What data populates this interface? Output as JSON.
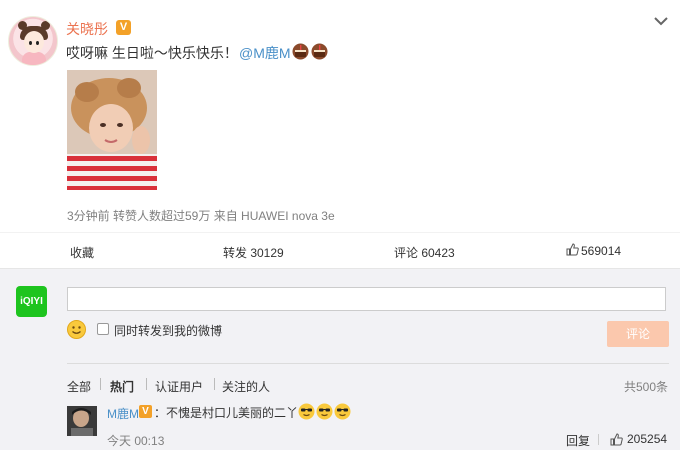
{
  "post": {
    "username": "关晓彤",
    "verified_badge": "V",
    "text": "哎呀嘛 生日啦～快乐快乐！",
    "mention": "@M鹿M",
    "emoji": [
      "cake-icon",
      "cake-icon"
    ],
    "meta": "3分钟前 转赞人数超过59万 来自 HUAWEI nova 3e"
  },
  "actions": {
    "favorite": "收藏",
    "repost": "转发 30129",
    "comment": "评论 60423",
    "like": "569014"
  },
  "composer": {
    "app_icon_label": "iQIYI",
    "input_value": "",
    "repost_checkbox_label": "同时转发到我的微博",
    "submit_label": "评论"
  },
  "comments": {
    "filters": [
      "全部",
      "热门",
      "认证用户",
      "关注的人"
    ],
    "active_filter": "热门",
    "total": "共500条",
    "items": [
      {
        "user": "M鹿M",
        "badge": "V",
        "text": "：不愧是村口儿美丽的二丫",
        "emoji": [
          "sunglasses-face-icon",
          "sunglasses-face-icon",
          "sunglasses-face-icon"
        ],
        "time": "今天 00:13",
        "reply_label": "回复",
        "likes": "205254"
      }
    ]
  },
  "colors": {
    "username": "#eb7350",
    "link": "#4a90c8",
    "verified": "#f3a128",
    "submit_disabled": "#fbc8ad",
    "iqiyi_green": "#1ec41e",
    "comment_bg": "#f2f2f5"
  }
}
